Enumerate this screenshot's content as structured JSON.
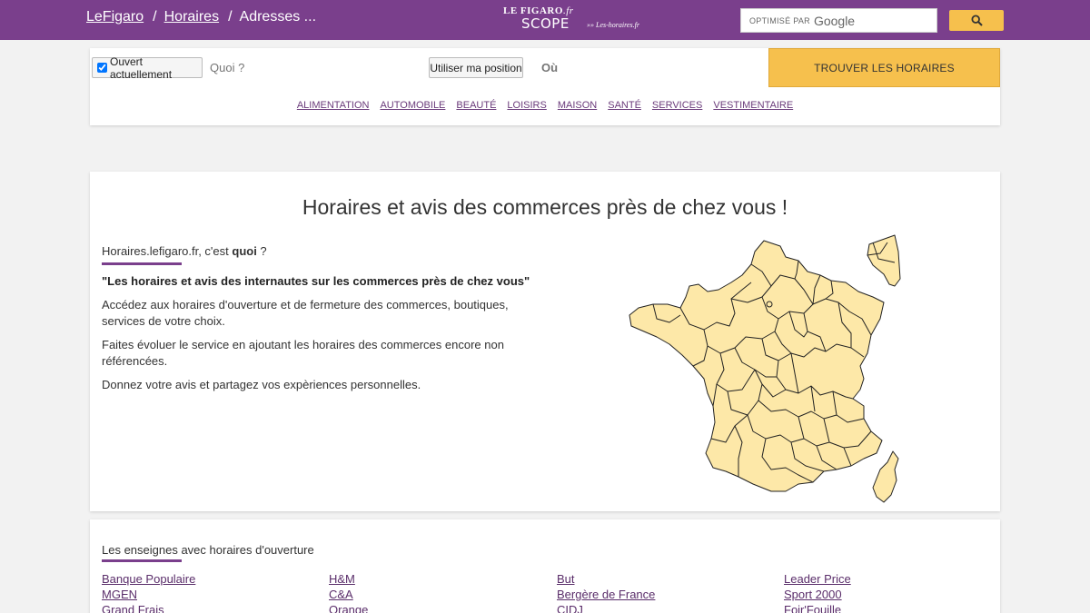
{
  "header": {
    "breadcrumbs": [
      {
        "label": "LeFigaro"
      },
      {
        "label": "Horaires"
      },
      {
        "label": "Adresses ..."
      }
    ],
    "logo": {
      "line1": "LE FIGARO",
      "line1_suffix": ".fr",
      "line2": "SCOPE",
      "line3": "Les-horaires.fr"
    },
    "search_prefix": "OPTIMISÉ PAR",
    "search_brand": "Google",
    "search_icon": "search-icon"
  },
  "search": {
    "open_now_label": "Ouvert actuellement",
    "open_now_checked": true,
    "what_placeholder": "Quoi ?",
    "use_position_label": "Utiliser ma position",
    "where_placeholder": "Où",
    "find_button": "TROUVER LES HORAIRES"
  },
  "categories": [
    "ALIMENTATION",
    "AUTOMOBILE",
    "BEAUTÉ",
    "LOISIRS",
    "MAISON",
    "SANTÉ",
    "SERVICES",
    "VESTIMENTAIRE"
  ],
  "main": {
    "title": "Horaires et avis des commerces près de chez vous !",
    "intro_prefix": "Horaires.lefigaro.fr, c'est ",
    "intro_bold": "quoi",
    "intro_suffix": " ?",
    "quote": "\"Les horaires et avis des internautes sur les commerces près de chez vous\"",
    "paragraphs": [
      "Accédez aux horaires d'ouverture et de fermeture des commerces, boutiques, services de votre choix.",
      "Faites évoluer le service en ajoutant les horaires des commerces encore non référencées.",
      "Donnez votre avis et partagez vos expèriences personnelles."
    ],
    "map_fill": "#fde8a8",
    "map_stroke": "#222222"
  },
  "brands": {
    "title": "Les enseignes avec horaires d'ouverture",
    "columns": [
      [
        "Banque Populaire",
        "MGEN",
        "Grand Frais"
      ],
      [
        "H&M",
        "C&A",
        "Orange"
      ],
      [
        "But",
        "Bergère de France",
        "CIDJ"
      ],
      [
        "Leader Price",
        "Sport 2000",
        "Foir'Fouille"
      ]
    ]
  },
  "colors": {
    "brand": "#7a3f8c",
    "accent": "#f6c04d"
  }
}
